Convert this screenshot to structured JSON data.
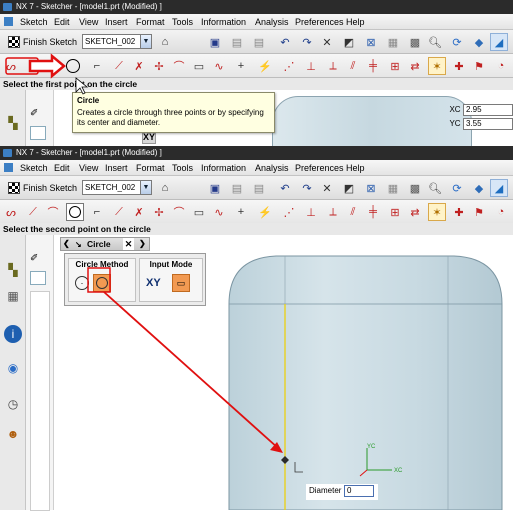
{
  "top": {
    "title": "NX 7 - Sketcher - [model1.prt (Modified) ]",
    "menu": [
      "Sketch",
      "Edit",
      "View",
      "Insert",
      "Format",
      "Tools",
      "Information",
      "Analysis",
      "Preferences",
      "Help"
    ],
    "finish_label": "Finish Sketch",
    "sketch_name": "SKETCH_002",
    "status": "Select the first point on the circle",
    "tooltip": {
      "title": "Circle",
      "body": "Creates a circle through three points or by specifying its center and diameter."
    },
    "xc_label": "XC",
    "xc_value": "2.95",
    "yc_label": "YC",
    "yc_value": "3.55"
  },
  "bottom": {
    "title": "NX 7 - Sketcher - [model1.prt (Modified) ]",
    "menu": [
      "Sketch",
      "Edit",
      "View",
      "Insert",
      "Format",
      "Tools",
      "Information",
      "Analysis",
      "Preferences",
      "Help"
    ],
    "finish_label": "Finish Sketch",
    "sketch_name": "SKETCH_002",
    "status": "Select the second point on the circle",
    "dialog_title": "Circle",
    "circle_method": "Circle Method",
    "input_mode": "Input Mode",
    "xy_label": "XY",
    "diameter_label": "Diameter",
    "diameter_value": "0",
    "axis_yc": "YC",
    "axis_xc": "XC"
  },
  "colors": {
    "accent_red": "#e01010",
    "guide_yellow": "#e8d020",
    "part_fill": "#cfdfe6",
    "dialog_highlight": "#f29a52"
  }
}
